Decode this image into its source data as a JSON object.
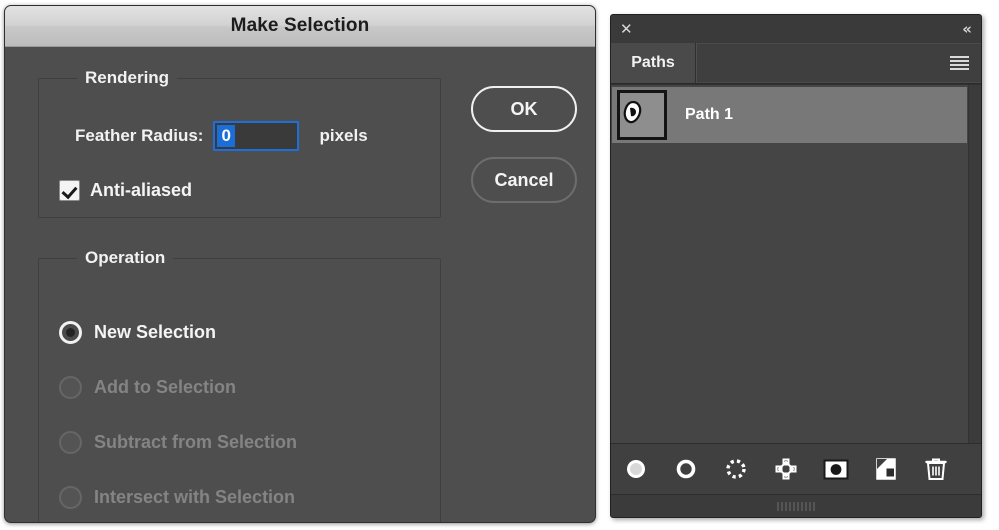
{
  "dialog": {
    "title": "Make Selection",
    "rendering": {
      "legend": "Rendering",
      "feather_label": "Feather Radius:",
      "feather_value": "0",
      "feather_placeholder": "0",
      "feather_units": "pixels",
      "antialias_label": "Anti-aliased",
      "antialias_checked": "checked"
    },
    "operation": {
      "legend": "Operation",
      "options": [
        {
          "label": "New Selection",
          "selected": "true",
          "disabled": "false"
        },
        {
          "label": "Add to Selection",
          "selected": "false",
          "disabled": "true"
        },
        {
          "label": "Subtract from Selection",
          "selected": "false",
          "disabled": "true"
        },
        {
          "label": "Intersect with Selection",
          "selected": "false",
          "disabled": "true"
        }
      ]
    },
    "buttons": {
      "ok": "OK",
      "cancel": "Cancel"
    }
  },
  "panel": {
    "close_icon": "✕",
    "collapse_icon": "«",
    "tab": "Paths",
    "menu_icon": "hamburger-menu-icon",
    "paths": [
      {
        "name": "Path 1",
        "selected": "true"
      }
    ],
    "toolbar": [
      {
        "name": "fill-path-with-foreground-color",
        "icon": "filled-circle-icon"
      },
      {
        "name": "stroke-path-with-brush",
        "icon": "circle-outline-icon"
      },
      {
        "name": "load-path-as-selection",
        "icon": "dashed-circle-icon"
      },
      {
        "name": "make-work-path-from-selection",
        "icon": "diamond-nodes-icon"
      },
      {
        "name": "add-layer-mask",
        "icon": "mask-icon"
      },
      {
        "name": "create-new-path",
        "icon": "new-page-icon"
      },
      {
        "name": "delete-current-path",
        "icon": "trash-icon"
      }
    ]
  },
  "colors": {
    "dialog_bg": "#4e4e4e",
    "panel_bg": "#3b3b3b",
    "accent_blue": "#1b6ed8",
    "selected_row": "#787878"
  }
}
